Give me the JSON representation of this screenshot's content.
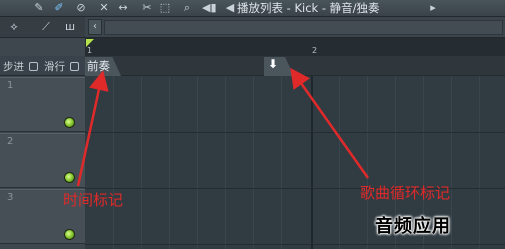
{
  "toolbar": {
    "title": "播放列表 - Kick - 静音/独奏",
    "icons": [
      "pencil-icon",
      "paint-icon",
      "delete-icon",
      "mute-icon",
      "slip-icon",
      "slice-icon",
      "select-icon",
      "zoom-icon",
      "playback-icon",
      "arrow-left-icon",
      "arrow-right-icon"
    ]
  },
  "left_panel": {
    "header_icons": [
      "snap-icon",
      "link-icon",
      "pattern-icon"
    ],
    "step_label": "步进",
    "slide_label": "滑行",
    "tracks": [
      {
        "number": "1"
      },
      {
        "number": "2"
      },
      {
        "number": "3"
      }
    ]
  },
  "ruler": {
    "bars": [
      "1",
      "2"
    ]
  },
  "markers": {
    "time_marker_label": "前奏",
    "loop_marker_icon": "⬇"
  },
  "annotations": {
    "time_marker": "时间标记",
    "loop_marker": "歌曲循环标记"
  },
  "watermark": "音频应用",
  "colors": {
    "accent_green": "#8fd13f",
    "annotation_red": "#e02a2a",
    "grid_bg": "#303b42"
  }
}
